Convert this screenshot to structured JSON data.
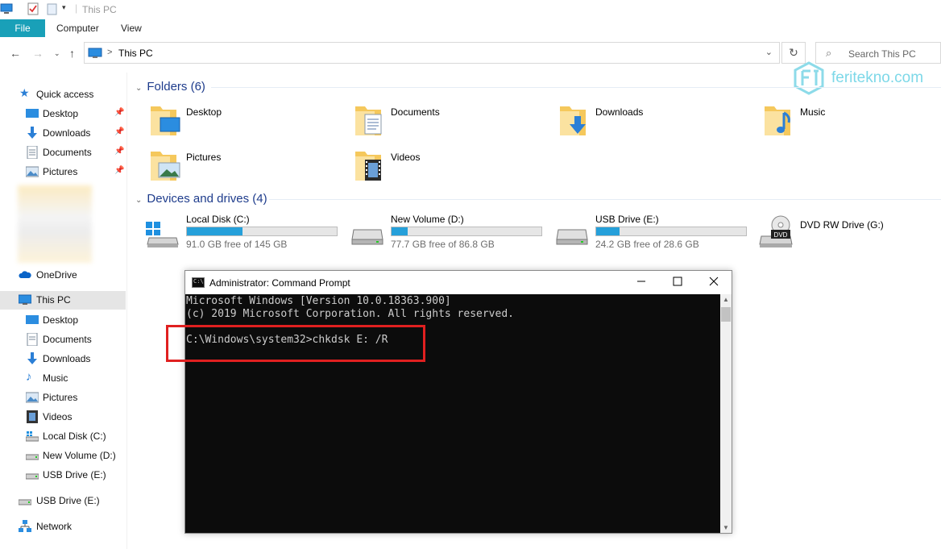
{
  "window": {
    "title": "This PC"
  },
  "ribbon": {
    "tabs": [
      "File",
      "Computer",
      "View"
    ]
  },
  "address": {
    "path": "This PC",
    "search_placeholder": "Search This PC"
  },
  "sidebar": {
    "quick_access": "Quick access",
    "quick_items": [
      "Desktop",
      "Downloads",
      "Documents",
      "Pictures"
    ],
    "onedrive": "OneDrive",
    "this_pc": "This PC",
    "pc_items": [
      "Desktop",
      "Documents",
      "Downloads",
      "Music",
      "Pictures",
      "Videos",
      "Local Disk (C:)",
      "New Volume (D:)",
      "USB Drive (E:)"
    ],
    "usb": "USB Drive (E:)",
    "network": "Network"
  },
  "folders": {
    "header": "Folders (6)",
    "items": [
      "Desktop",
      "Documents",
      "Downloads",
      "Music",
      "Pictures",
      "Videos"
    ]
  },
  "drives": {
    "header": "Devices and drives (4)",
    "items": [
      {
        "name": "Local Disk (C:)",
        "free": "91.0 GB free of 145 GB",
        "used_fraction": 0.37
      },
      {
        "name": "New Volume (D:)",
        "free": "77.7 GB free of 86.8 GB",
        "used_fraction": 0.105
      },
      {
        "name": "USB Drive (E:)",
        "free": "24.2 GB free of 28.6 GB",
        "used_fraction": 0.155
      },
      {
        "name": "DVD RW Drive (G:)",
        "badge": "DVD"
      }
    ]
  },
  "watermark": "feritekno.com",
  "cmd": {
    "title": "Administrator: Command Prompt",
    "icon_text": "C:\\",
    "lines": [
      "Microsoft Windows [Version 10.0.18363.900]",
      "(c) 2019 Microsoft Corporation. All rights reserved.",
      "",
      "C:\\Windows\\system32>chkdsk E: /R"
    ]
  },
  "colors": {
    "accent": "#19a0b8",
    "progress": "#26a0da",
    "highlight_box": "#e02020",
    "console_bg": "#0c0c0c"
  }
}
